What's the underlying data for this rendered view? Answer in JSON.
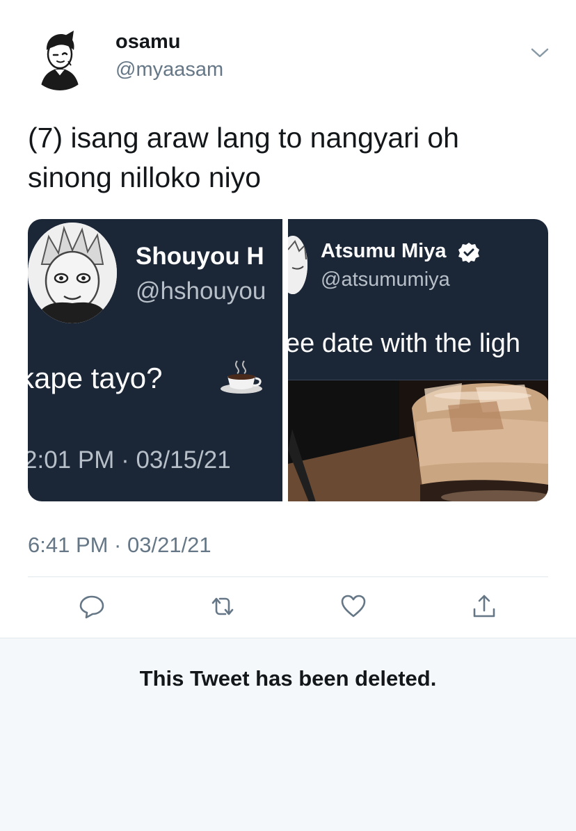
{
  "tweet": {
    "display_name": "osamu",
    "handle": "@myaasam",
    "text_line1": "(7) isang araw lang to nangyari oh",
    "text_line2": "sinong nilloko niyo",
    "timestamp": "6:41 PM · 03/21/21"
  },
  "media": {
    "left": {
      "name": "Shouyou H",
      "handle": "@hshouyou",
      "text": "kape tayo?",
      "emoji": "hot-coffee",
      "time": "2:01 PM · 03/15/21"
    },
    "right": {
      "name": "Atsumu Miya",
      "handle": "@atsumumiya",
      "text": "ee date with the ligh",
      "verified": true
    }
  },
  "actions": {
    "reply_icon": "reply-icon",
    "retweet_icon": "retweet-icon",
    "like_icon": "heart-icon",
    "share_icon": "share-icon"
  },
  "deleted_notice": "This Tweet has been deleted.",
  "colors": {
    "text": "#14171a",
    "secondary": "#657786",
    "card_bg": "#1b2637",
    "verified_badge": "#ffffff",
    "deleted_bg": "#f5f8fa"
  }
}
